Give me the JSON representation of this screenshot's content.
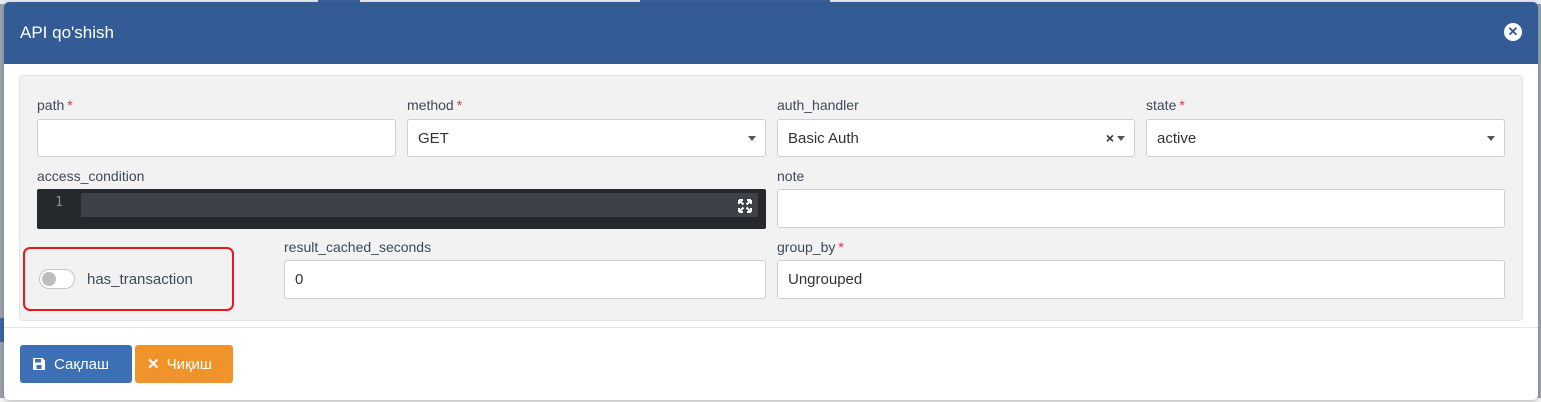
{
  "modal": {
    "title": "API qo'shish",
    "close_icon": "close-circle-icon"
  },
  "form": {
    "path": {
      "label": "path",
      "required": "*",
      "value": ""
    },
    "method": {
      "label": "method",
      "required": "*",
      "value": "GET"
    },
    "auth_handler": {
      "label": "auth_handler",
      "value": "Basic Auth",
      "clear": "×"
    },
    "state": {
      "label": "state",
      "required": "*",
      "value": "active"
    },
    "access_condition": {
      "label": "access_condition",
      "line_number": "1"
    },
    "note": {
      "label": "note",
      "value": ""
    },
    "has_transaction": {
      "label": "has_transaction",
      "checked": false
    },
    "result_cached_seconds": {
      "label": "result_cached_seconds",
      "value": "0"
    },
    "group_by": {
      "label": "group_by",
      "required": "*",
      "value": "Ungrouped"
    }
  },
  "footer": {
    "save_label": "Сақлаш",
    "exit_label": "Чиқиш"
  },
  "colors": {
    "header": "#335c97",
    "save": "#3d6fb4",
    "exit": "#f0932b",
    "highlight": "#e8191d"
  }
}
